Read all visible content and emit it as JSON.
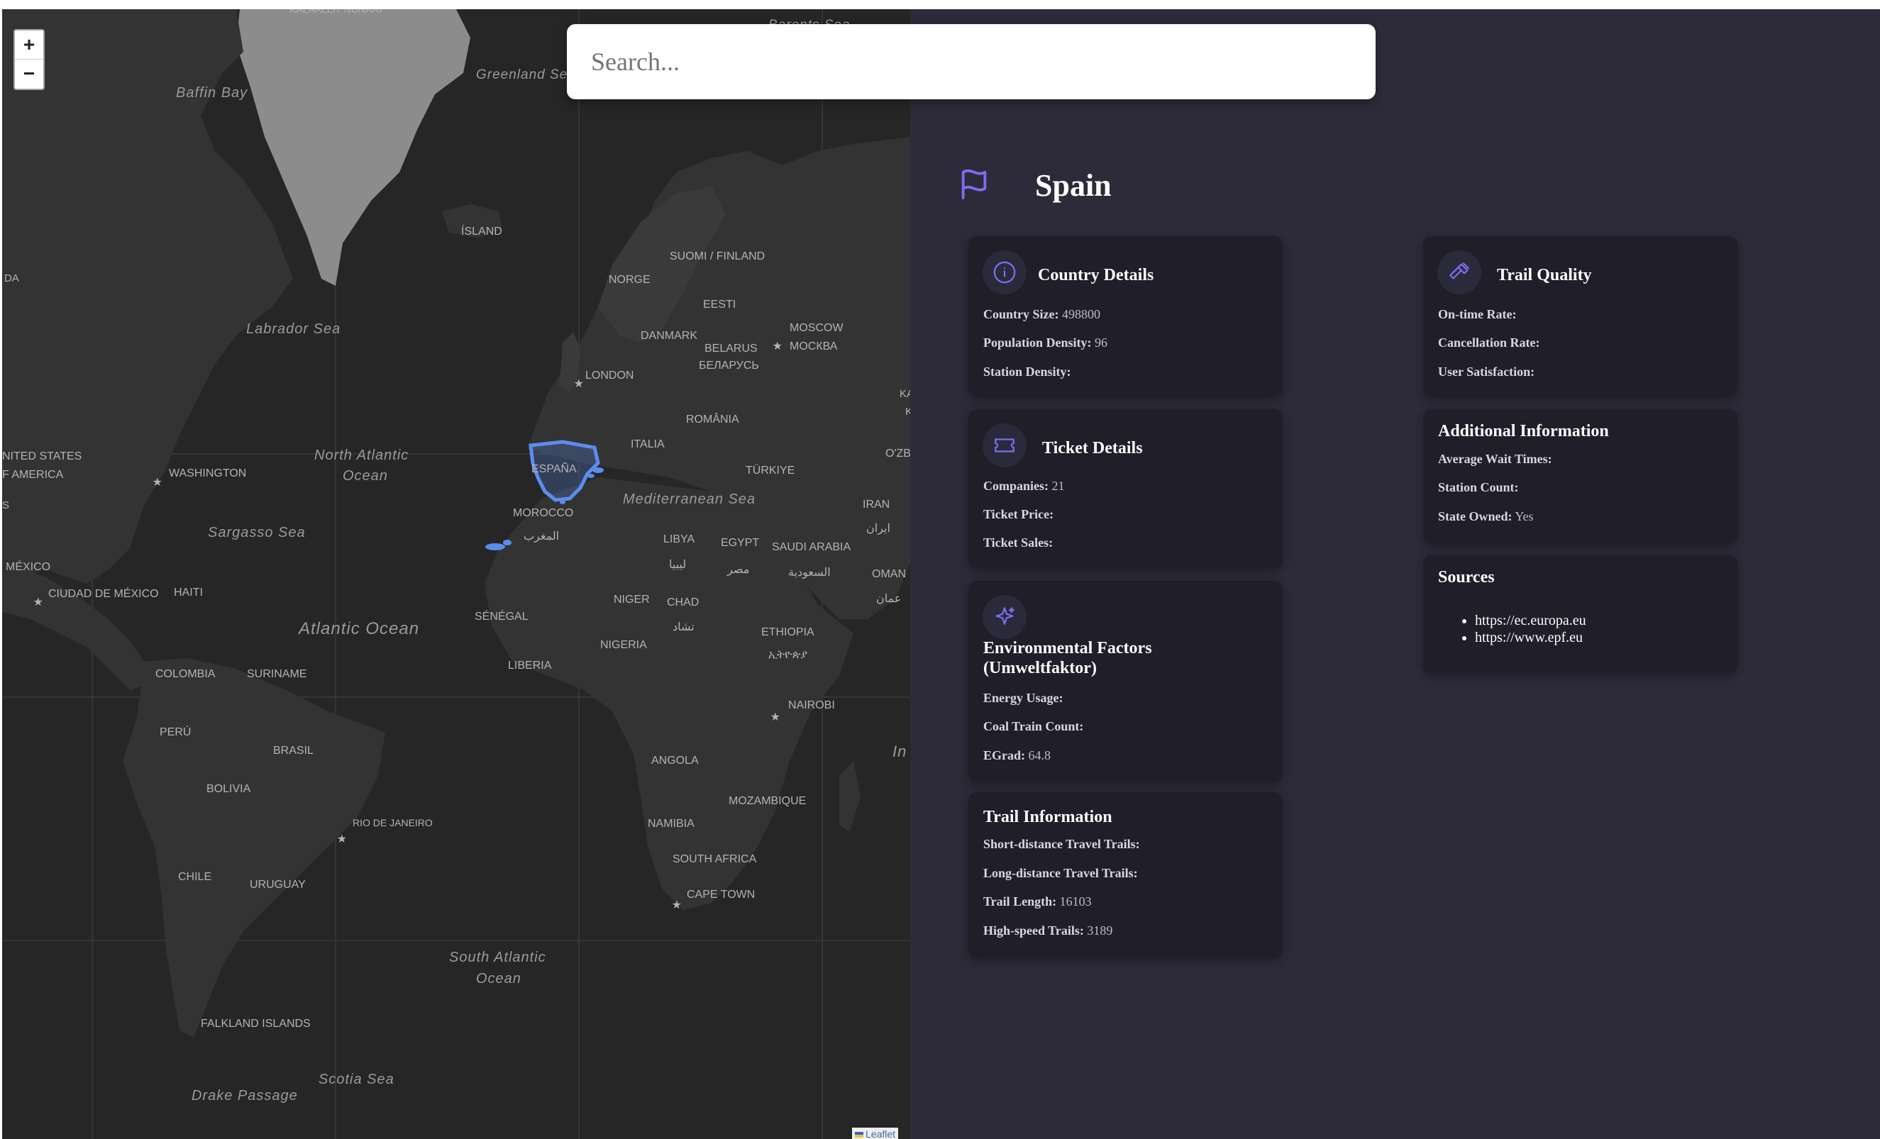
{
  "search": {
    "placeholder": "Search..."
  },
  "zoom": {
    "in": "+",
    "out": "−"
  },
  "attribution": "Leaflet",
  "map": {
    "highlight_color": "#5b8def",
    "labels": [
      {
        "id": "kalaallit",
        "text": "KALAALLIT NUNAAT"
      },
      {
        "id": "baffin",
        "text": "Baffin Bay"
      },
      {
        "id": "greenland-sea",
        "text": "Greenland Sea"
      },
      {
        "id": "barents",
        "text": "Barents Sea"
      },
      {
        "id": "island",
        "text": "ÍSLAND"
      },
      {
        "id": "da",
        "text": "DA"
      },
      {
        "id": "labrador",
        "text": "Labrador Sea"
      },
      {
        "id": "suomi",
        "text": "SUOMI / FINLAND"
      },
      {
        "id": "norge",
        "text": "NORGE"
      },
      {
        "id": "eesti",
        "text": "EESTI"
      },
      {
        "id": "danmark",
        "text": "DANMARK"
      },
      {
        "id": "moscow",
        "text": "MOSCOW"
      },
      {
        "id": "moskva",
        "text": "МОСКВА"
      },
      {
        "id": "belarus",
        "text": "BELARUS"
      },
      {
        "id": "belarus-cyr",
        "text": "БЕЛАРУСЬ"
      },
      {
        "id": "london",
        "text": "LONDON"
      },
      {
        "id": "ka",
        "text": "KA"
      },
      {
        "id": "k",
        "text": "K"
      },
      {
        "id": "romania",
        "text": "ROMÂNIA"
      },
      {
        "id": "usa1",
        "text": "NITED STATES"
      },
      {
        "id": "usa2",
        "text": "F AMERICA"
      },
      {
        "id": "north-atlantic1",
        "text": "North Atlantic"
      },
      {
        "id": "north-atlantic2",
        "text": "Ocean"
      },
      {
        "id": "washington",
        "text": "WASHINGTON"
      },
      {
        "id": "espana",
        "text": "ESPAÑA"
      },
      {
        "id": "italia",
        "text": "ITALIA"
      },
      {
        "id": "turkiye",
        "text": "TÜRKIYE"
      },
      {
        "id": "ozb",
        "text": "O'ZB"
      },
      {
        "id": "mediterranean",
        "text": "Mediterranean Sea"
      },
      {
        "id": "s",
        "text": "S"
      },
      {
        "id": "iran",
        "text": "IRAN"
      },
      {
        "id": "iran-ar",
        "text": "ایران"
      },
      {
        "id": "sargasso",
        "text": "Sargasso Sea"
      },
      {
        "id": "morocco",
        "text": "MOROCCO"
      },
      {
        "id": "morocco-ar",
        "text": "المغرب"
      },
      {
        "id": "libya",
        "text": "LIBYA"
      },
      {
        "id": "libya-ar",
        "text": "ليبيا"
      },
      {
        "id": "egypt",
        "text": "EGYPT"
      },
      {
        "id": "egypt-ar",
        "text": "مصر"
      },
      {
        "id": "saudi",
        "text": "SAUDI ARABIA"
      },
      {
        "id": "saudi-ar",
        "text": "السعودية"
      },
      {
        "id": "mexico",
        "text": "MÉXICO"
      },
      {
        "id": "cdmx",
        "text": "CIUDAD DE MÉXICO"
      },
      {
        "id": "haiti",
        "text": "HAITI"
      },
      {
        "id": "oman",
        "text": "OMAN"
      },
      {
        "id": "oman-ar",
        "text": "عمان"
      },
      {
        "id": "atlantic",
        "text": "Atlantic Ocean"
      },
      {
        "id": "senegal",
        "text": "SÉNÉGAL"
      },
      {
        "id": "niger",
        "text": "NIGER"
      },
      {
        "id": "chad",
        "text": "CHAD"
      },
      {
        "id": "chad-ar",
        "text": "تشاد"
      },
      {
        "id": "ethiopia",
        "text": "ETHIOPIA"
      },
      {
        "id": "ethiopia-am",
        "text": "ኢትዮጵያ"
      },
      {
        "id": "nigeria",
        "text": "NIGERIA"
      },
      {
        "id": "liberia",
        "text": "LIBERIA"
      },
      {
        "id": "colombia",
        "text": "COLOMBIA"
      },
      {
        "id": "suriname",
        "text": "SURINAME"
      },
      {
        "id": "nairobi",
        "text": "NAIROBI"
      },
      {
        "id": "peru",
        "text": "PERÚ"
      },
      {
        "id": "brasil",
        "text": "BRASIL"
      },
      {
        "id": "angola",
        "text": "ANGOLA"
      },
      {
        "id": "in",
        "text": "In"
      },
      {
        "id": "bolivia",
        "text": "BOLIVIA"
      },
      {
        "id": "mozambique",
        "text": "MOZAMBIQUE"
      },
      {
        "id": "namibia",
        "text": "NAMIBIA"
      },
      {
        "id": "rio",
        "text": "RIO DE JANEIRO"
      },
      {
        "id": "south-africa",
        "text": "SOUTH AFRICA"
      },
      {
        "id": "chile",
        "text": "CHILE"
      },
      {
        "id": "uruguay",
        "text": "URUGUAY"
      },
      {
        "id": "cape-town",
        "text": "CAPE TOWN"
      },
      {
        "id": "south-atlantic1",
        "text": "South Atlantic"
      },
      {
        "id": "south-atlantic2",
        "text": "Ocean"
      },
      {
        "id": "falkland",
        "text": "FALKLAND ISLANDS"
      },
      {
        "id": "scotia",
        "text": "Scotia Sea"
      },
      {
        "id": "drake",
        "text": "Drake Passage"
      }
    ]
  },
  "panel": {
    "country": "Spain",
    "accent": "#7c6cf0",
    "country_details": {
      "title": "Country Details",
      "rows": [
        {
          "label": "Country Size:",
          "value": "498800"
        },
        {
          "label": "Population Density:",
          "value": "96"
        },
        {
          "label": "Station Density:",
          "value": ""
        }
      ]
    },
    "ticket_details": {
      "title": "Ticket Details",
      "rows": [
        {
          "label": "Companies:",
          "value": "21"
        },
        {
          "label": "Ticket Price:",
          "value": ""
        },
        {
          "label": "Ticket Sales:",
          "value": ""
        }
      ]
    },
    "environmental": {
      "title_line1": "Environmental Factors",
      "title_line2": "(Umweltfaktor)",
      "rows": [
        {
          "label": "Energy Usage:",
          "value": ""
        },
        {
          "label": "Coal Train Count:",
          "value": ""
        },
        {
          "label": "EGrad:",
          "value": "64.8"
        }
      ]
    },
    "trail_information": {
      "title": "Trail Information",
      "rows": [
        {
          "label": "Short-distance Travel Trails:",
          "value": ""
        },
        {
          "label": "Long-distance Travel Trails:",
          "value": ""
        },
        {
          "label": "Trail Length:",
          "value": "16103"
        },
        {
          "label": "High-speed Trails:",
          "value": "3189"
        }
      ]
    },
    "trail_quality": {
      "title": "Trail Quality",
      "rows": [
        {
          "label": "On-time Rate:",
          "value": ""
        },
        {
          "label": "Cancellation Rate:",
          "value": ""
        },
        {
          "label": "User Satisfaction:",
          "value": ""
        }
      ]
    },
    "additional_information": {
      "title": "Additional Information",
      "rows": [
        {
          "label": "Average Wait Times:",
          "value": ""
        },
        {
          "label": "Station Count:",
          "value": ""
        },
        {
          "label": "State Owned:",
          "value": "Yes"
        }
      ]
    },
    "sources": {
      "title": "Sources",
      "items": [
        "https://ec.europa.eu",
        "https://www.epf.eu"
      ]
    }
  }
}
